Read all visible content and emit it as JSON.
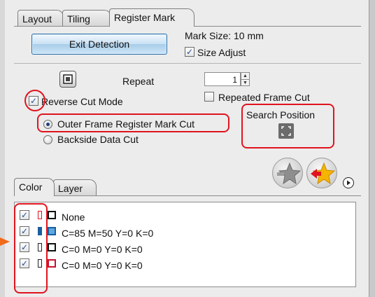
{
  "tabs": [
    "Layout",
    "Tiling",
    "Register Mark"
  ],
  "register_mark": {
    "exit_detection_label": "Exit Detection",
    "mark_size_label": "Mark Size:",
    "mark_size_value": "10 mm",
    "size_adjust_label": "Size Adjust",
    "size_adjust_checked": true,
    "repeat_label": "Repeat",
    "repeat_value": "1",
    "repeated_frame_cut_label": "Repeated Frame Cut",
    "repeated_frame_cut_checked": false,
    "reverse_cut_mode_label": "Reverse Cut Mode",
    "reverse_cut_mode_checked": true,
    "outer_frame_label": "Outer Frame Register Mark Cut",
    "backside_label": "Backside Data Cut",
    "selected_mode": "Outer Frame Register Mark Cut",
    "search_position_label": "Search Position"
  },
  "bottom_tabs": [
    "Color",
    "Layer"
  ],
  "color_list": [
    {
      "label": "None",
      "checked": true,
      "color": "#ffffff",
      "border": "#111111",
      "bar": "#e0141e"
    },
    {
      "label": "C=85 M=50 Y=0 K=0",
      "checked": true,
      "color": "#2a7fc4",
      "border": "#1a5ea0",
      "bar": "#1a5ea0"
    },
    {
      "label": "C=0 M=0 Y=0 K=0",
      "checked": true,
      "color": "#ffffff",
      "border": "#111111",
      "bar": "#ffffff"
    },
    {
      "label": "C=0 M=0 Y=0 K=0",
      "checked": true,
      "color": "#ffffff",
      "border": "#c8102e",
      "bar": "#ffffff"
    }
  ],
  "colors": {
    "highlight": "#e0141e",
    "arrow": "#f26a1b",
    "button_border": "#2a6fa8"
  }
}
